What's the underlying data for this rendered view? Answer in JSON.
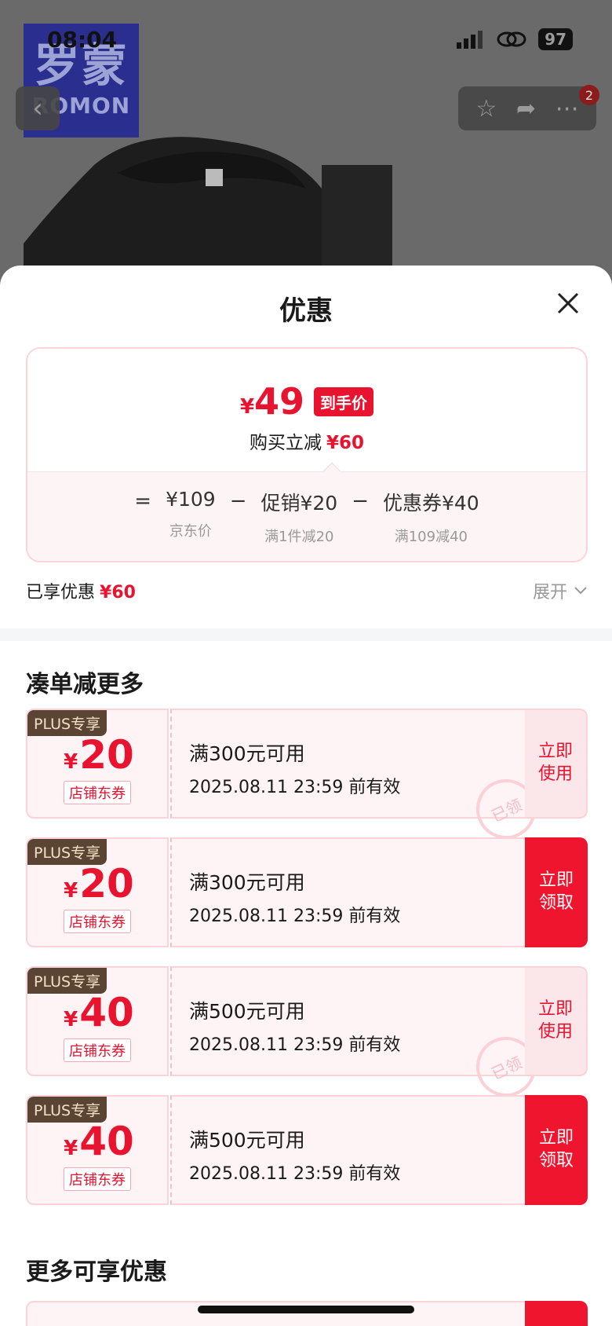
{
  "status_bar": {
    "time": "08:04",
    "battery": "97"
  },
  "product": {
    "logo_cn": "罗蒙",
    "logo_en": "ROMON",
    "notification_count": "2"
  },
  "sheet": {
    "title": "优惠"
  },
  "price_card": {
    "currency": "¥",
    "final_price": "49",
    "final_tag": "到手价",
    "reduce_label": "购买立减",
    "reduce_value": "¥60",
    "formula": {
      "equals": "=",
      "minus": "−",
      "base_value": "¥109",
      "base_label": "京东价",
      "promo_value": "促销¥20",
      "promo_label": "满1件减20",
      "coupon_value": "优惠券¥40",
      "coupon_label": "满109减40"
    }
  },
  "saved": {
    "label": "已享优惠",
    "value": "¥60",
    "expand": "展开"
  },
  "sections": {
    "more_savings": "凑单减更多",
    "more_offers": "更多可享优惠"
  },
  "coupons": [
    {
      "tag": "PLUS专享",
      "currency": "¥",
      "amount": "20",
      "type": "店铺东券",
      "condition": "满300元可用",
      "valid": "2025.08.11 23:59 前有效",
      "action": "立即使用",
      "stamp": "已领"
    },
    {
      "tag": "PLUS专享",
      "currency": "¥",
      "amount": "20",
      "type": "店铺东券",
      "condition": "满300元可用",
      "valid": "2025.08.11 23:59 前有效",
      "action": "立即领取"
    },
    {
      "tag": "PLUS专享",
      "currency": "¥",
      "amount": "40",
      "type": "店铺东券",
      "condition": "满500元可用",
      "valid": "2025.08.11 23:59 前有效",
      "action": "立即使用",
      "stamp": "已领"
    },
    {
      "tag": "PLUS专享",
      "currency": "¥",
      "amount": "40",
      "type": "店铺东券",
      "condition": "满500元可用",
      "valid": "2025.08.11 23:59 前有效",
      "action": "立即领取"
    }
  ],
  "colors": {
    "accent": "#e8132f",
    "plus_tag": "#5a4434",
    "coupon_bg": "#fef3f5"
  }
}
